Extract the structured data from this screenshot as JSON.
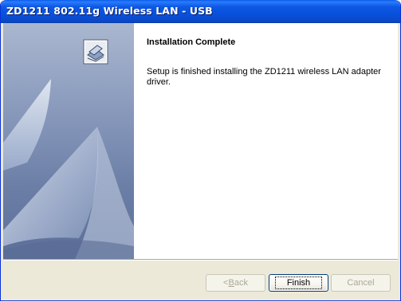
{
  "window": {
    "title": "ZD1211 802.11g Wireless LAN - USB"
  },
  "page": {
    "heading": "Installation Complete",
    "message": "Setup is finished installing the ZD1211 wireless LAN adapter driver."
  },
  "buttons": {
    "back_prefix": "< ",
    "back_mnemonic": "B",
    "back_rest": "ack",
    "finish_label": "Finish",
    "cancel_label": "Cancel"
  },
  "icons": {
    "setup": "setup-computer-icon",
    "side_graphic": "sailboat-decoration"
  }
}
